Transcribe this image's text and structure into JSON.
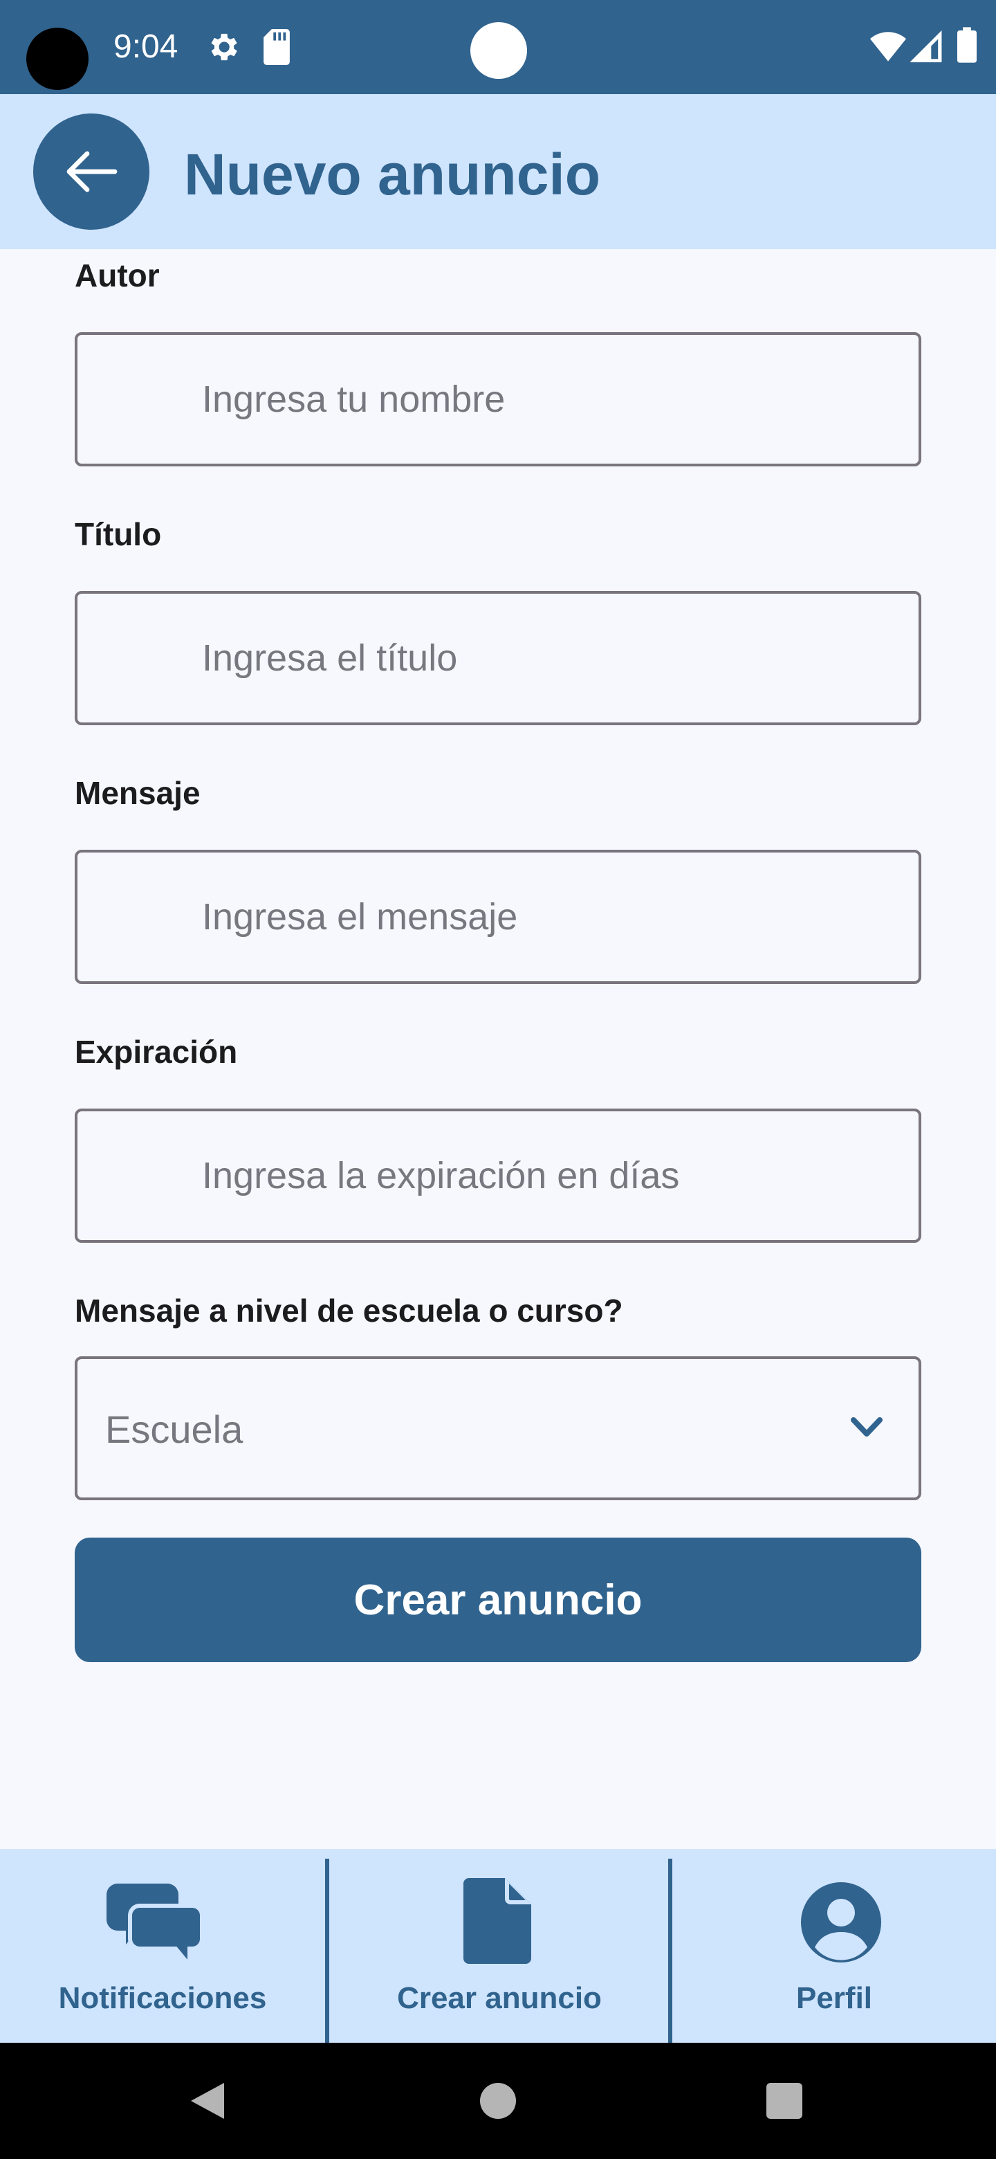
{
  "status_bar": {
    "time": "9:04",
    "icons": [
      "gear-icon",
      "sd-card-icon",
      "wifi-icon",
      "signal-icon",
      "battery-icon"
    ]
  },
  "app_bar": {
    "title": "Nuevo anuncio",
    "back_icon": "arrow-left-icon"
  },
  "form": {
    "author": {
      "label": "Autor",
      "placeholder": "Ingresa tu nombre",
      "value": ""
    },
    "title": {
      "label": "Título",
      "placeholder": "Ingresa el título",
      "value": ""
    },
    "message": {
      "label": "Mensaje",
      "placeholder": "Ingresa el mensaje",
      "value": ""
    },
    "expiration": {
      "label": "Expiración",
      "placeholder": "Ingresa la expiración en días",
      "value": ""
    },
    "scope": {
      "label": "Mensaje a nivel de escuela o curso?",
      "selected": "Escuela"
    },
    "submit_label": "Crear anuncio"
  },
  "bottom_nav": {
    "items": [
      {
        "label": "Notificaciones",
        "icon": "chat-bubbles-icon"
      },
      {
        "label": "Crear anuncio",
        "icon": "document-icon"
      },
      {
        "label": "Perfil",
        "icon": "account-circle-icon"
      }
    ]
  },
  "system_nav": {
    "icons": [
      "back-triangle-icon",
      "home-circle-icon",
      "recents-square-icon"
    ]
  },
  "colors": {
    "primary": "#30638e",
    "app_bar_bg": "#cfe4fd",
    "page_bg": "#f6f8fd",
    "outline": "#79747e",
    "placeholder": "#77777f"
  }
}
